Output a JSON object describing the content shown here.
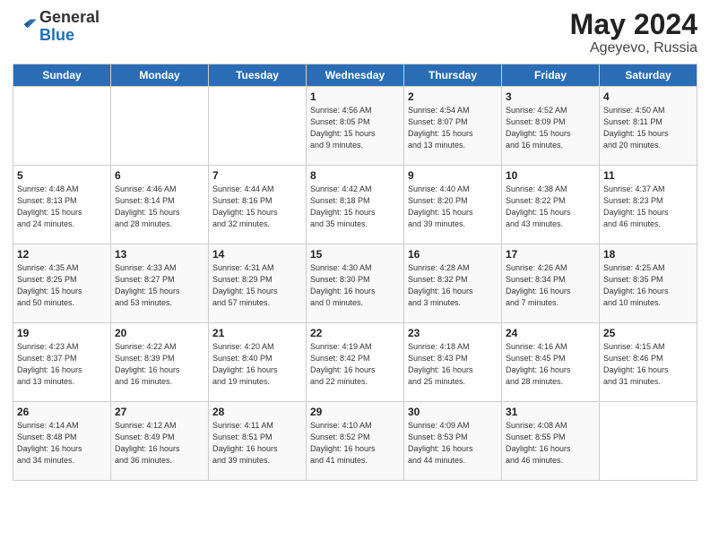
{
  "logo": {
    "general": "General",
    "blue": "Blue"
  },
  "header": {
    "month_year": "May 2024",
    "location": "Ageyevo, Russia"
  },
  "days_of_week": [
    "Sunday",
    "Monday",
    "Tuesday",
    "Wednesday",
    "Thursday",
    "Friday",
    "Saturday"
  ],
  "weeks": [
    [
      {
        "day": "",
        "info": ""
      },
      {
        "day": "",
        "info": ""
      },
      {
        "day": "",
        "info": ""
      },
      {
        "day": "1",
        "info": "Sunrise: 4:56 AM\nSunset: 8:05 PM\nDaylight: 15 hours\nand 9 minutes."
      },
      {
        "day": "2",
        "info": "Sunrise: 4:54 AM\nSunset: 8:07 PM\nDaylight: 15 hours\nand 13 minutes."
      },
      {
        "day": "3",
        "info": "Sunrise: 4:52 AM\nSunset: 8:09 PM\nDaylight: 15 hours\nand 16 minutes."
      },
      {
        "day": "4",
        "info": "Sunrise: 4:50 AM\nSunset: 8:11 PM\nDaylight: 15 hours\nand 20 minutes."
      }
    ],
    [
      {
        "day": "5",
        "info": "Sunrise: 4:48 AM\nSunset: 8:13 PM\nDaylight: 15 hours\nand 24 minutes."
      },
      {
        "day": "6",
        "info": "Sunrise: 4:46 AM\nSunset: 8:14 PM\nDaylight: 15 hours\nand 28 minutes."
      },
      {
        "day": "7",
        "info": "Sunrise: 4:44 AM\nSunset: 8:16 PM\nDaylight: 15 hours\nand 32 minutes."
      },
      {
        "day": "8",
        "info": "Sunrise: 4:42 AM\nSunset: 8:18 PM\nDaylight: 15 hours\nand 35 minutes."
      },
      {
        "day": "9",
        "info": "Sunrise: 4:40 AM\nSunset: 8:20 PM\nDaylight: 15 hours\nand 39 minutes."
      },
      {
        "day": "10",
        "info": "Sunrise: 4:38 AM\nSunset: 8:22 PM\nDaylight: 15 hours\nand 43 minutes."
      },
      {
        "day": "11",
        "info": "Sunrise: 4:37 AM\nSunset: 8:23 PM\nDaylight: 15 hours\nand 46 minutes."
      }
    ],
    [
      {
        "day": "12",
        "info": "Sunrise: 4:35 AM\nSunset: 8:25 PM\nDaylight: 15 hours\nand 50 minutes."
      },
      {
        "day": "13",
        "info": "Sunrise: 4:33 AM\nSunset: 8:27 PM\nDaylight: 15 hours\nand 53 minutes."
      },
      {
        "day": "14",
        "info": "Sunrise: 4:31 AM\nSunset: 8:29 PM\nDaylight: 15 hours\nand 57 minutes."
      },
      {
        "day": "15",
        "info": "Sunrise: 4:30 AM\nSunset: 8:30 PM\nDaylight: 16 hours\nand 0 minutes."
      },
      {
        "day": "16",
        "info": "Sunrise: 4:28 AM\nSunset: 8:32 PM\nDaylight: 16 hours\nand 3 minutes."
      },
      {
        "day": "17",
        "info": "Sunrise: 4:26 AM\nSunset: 8:34 PM\nDaylight: 16 hours\nand 7 minutes."
      },
      {
        "day": "18",
        "info": "Sunrise: 4:25 AM\nSunset: 8:35 PM\nDaylight: 16 hours\nand 10 minutes."
      }
    ],
    [
      {
        "day": "19",
        "info": "Sunrise: 4:23 AM\nSunset: 8:37 PM\nDaylight: 16 hours\nand 13 minutes."
      },
      {
        "day": "20",
        "info": "Sunrise: 4:22 AM\nSunset: 8:39 PM\nDaylight: 16 hours\nand 16 minutes."
      },
      {
        "day": "21",
        "info": "Sunrise: 4:20 AM\nSunset: 8:40 PM\nDaylight: 16 hours\nand 19 minutes."
      },
      {
        "day": "22",
        "info": "Sunrise: 4:19 AM\nSunset: 8:42 PM\nDaylight: 16 hours\nand 22 minutes."
      },
      {
        "day": "23",
        "info": "Sunrise: 4:18 AM\nSunset: 8:43 PM\nDaylight: 16 hours\nand 25 minutes."
      },
      {
        "day": "24",
        "info": "Sunrise: 4:16 AM\nSunset: 8:45 PM\nDaylight: 16 hours\nand 28 minutes."
      },
      {
        "day": "25",
        "info": "Sunrise: 4:15 AM\nSunset: 8:46 PM\nDaylight: 16 hours\nand 31 minutes."
      }
    ],
    [
      {
        "day": "26",
        "info": "Sunrise: 4:14 AM\nSunset: 8:48 PM\nDaylight: 16 hours\nand 34 minutes."
      },
      {
        "day": "27",
        "info": "Sunrise: 4:12 AM\nSunset: 8:49 PM\nDaylight: 16 hours\nand 36 minutes."
      },
      {
        "day": "28",
        "info": "Sunrise: 4:11 AM\nSunset: 8:51 PM\nDaylight: 16 hours\nand 39 minutes."
      },
      {
        "day": "29",
        "info": "Sunrise: 4:10 AM\nSunset: 8:52 PM\nDaylight: 16 hours\nand 41 minutes."
      },
      {
        "day": "30",
        "info": "Sunrise: 4:09 AM\nSunset: 8:53 PM\nDaylight: 16 hours\nand 44 minutes."
      },
      {
        "day": "31",
        "info": "Sunrise: 4:08 AM\nSunset: 8:55 PM\nDaylight: 16 hours\nand 46 minutes."
      },
      {
        "day": "",
        "info": ""
      }
    ]
  ]
}
